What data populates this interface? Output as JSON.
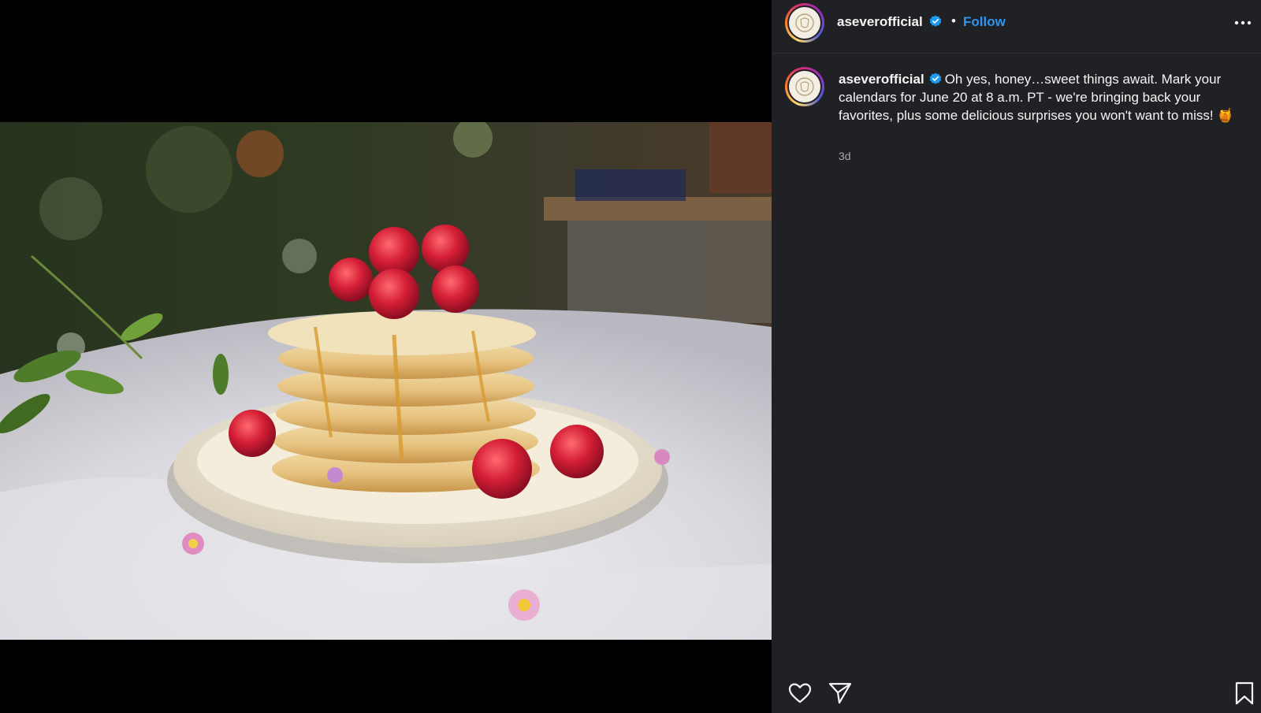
{
  "header": {
    "username": "aseverofficial",
    "separator": "•",
    "follow_label": "Follow",
    "more_icon": "more-horizontal-icon"
  },
  "caption": {
    "username": "aseverofficial",
    "text": "Oh yes, honey…sweet things await. Mark your calendars for June 20 at 8 a.m. PT - we're bringing back your favorites, plus some delicious surprises you won't want to miss! 🍯",
    "timestamp": "3d"
  },
  "actions": {
    "like_icon": "heart-icon",
    "share_icon": "paper-plane-icon",
    "save_icon": "bookmark-icon"
  },
  "colors": {
    "panel_bg": "#202125",
    "follow_blue": "#2f95f2",
    "verified_blue": "#1d9bf0",
    "muted_text": "#a8a8a8"
  },
  "image": {
    "subject": "stack of pancakes topped with raspberries and honey on a white plate outdoors"
  }
}
